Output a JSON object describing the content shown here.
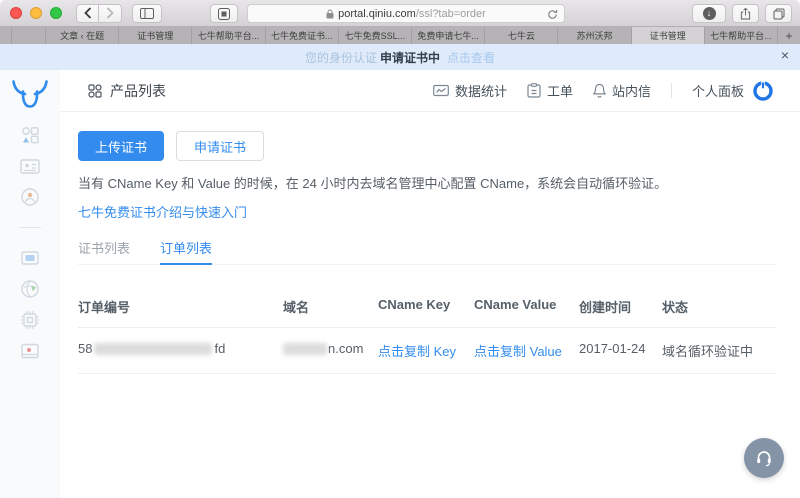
{
  "colors": {
    "accent": "#338ced",
    "logo_blue": "#2f8ced",
    "banner_bg": "#dfeafa",
    "banner_link": "#a6c9ef",
    "support_button": "#8493a6"
  },
  "browser": {
    "url_host": "portal.qiniu.com",
    "url_path": "/ssl?tab=order",
    "tabs": [
      {
        "label": ""
      },
      {
        "label": ""
      },
      {
        "label": "文章 ‹ 在题"
      },
      {
        "label": "证书管理"
      },
      {
        "label": "七牛帮助平台..."
      },
      {
        "label": "七牛免费证书..."
      },
      {
        "label": "七牛免费SSL..."
      },
      {
        "label": "免费申请七牛..."
      },
      {
        "label": "七牛云"
      },
      {
        "label": "苏州沃邦"
      },
      {
        "label": "证书管理"
      },
      {
        "label": "七牛帮助平台..."
      }
    ],
    "active_tab_index": 10,
    "new_tab_label": "+"
  },
  "banner": {
    "prefix": "您的身份认证",
    "status": "申请证书中",
    "link": "点击查看",
    "close_label": "×"
  },
  "header": {
    "title": "产品列表",
    "stats_label": "数据统计",
    "tickets_label": "工单",
    "messages_label": "站内信",
    "panel_label": "个人面板"
  },
  "main": {
    "upload_button": "上传证书",
    "apply_button": "申请证书",
    "tip": "当有 CName Key 和 Value 的时候，在 24 小时内去域名管理中心配置 CName，系统会自动循环验证。",
    "guide_link": "七牛免费证书介绍与快速入门",
    "tab_certificates": "证书列表",
    "tab_orders": "订单列表",
    "table": {
      "columns": [
        "订单编号",
        "域名",
        "CName Key",
        "CName Value",
        "创建时间",
        "状态"
      ],
      "row": {
        "order_prefix": "58",
        "order_suffix": "fd",
        "domain_visible": "n.com",
        "copy_key": "点击复制 Key",
        "copy_value": "点击复制 Value",
        "created": "2017-01-24",
        "status": "域名循环验证中"
      }
    }
  },
  "icons": {
    "logo": "qiniu-ox-logo",
    "browser": [
      "lock-icon",
      "refresh-icon",
      "downloads-icon",
      "share-icon",
      "tabs-overview-icon",
      "sidebar-toggle-icon",
      "extension-icon",
      "back-icon",
      "forward-icon"
    ],
    "header": [
      "grid-icon",
      "data-stats-icon",
      "ticket-clipboard-icon",
      "bell-icon",
      "panel-power-icon"
    ],
    "sidebar": [
      "products-grid-icon",
      "id-card-icon",
      "user-badge-icon",
      "storage-box-icon",
      "cdn-globe-icon",
      "compute-chip-icon",
      "media-player-icon"
    ],
    "floating": "headset-icon"
  }
}
